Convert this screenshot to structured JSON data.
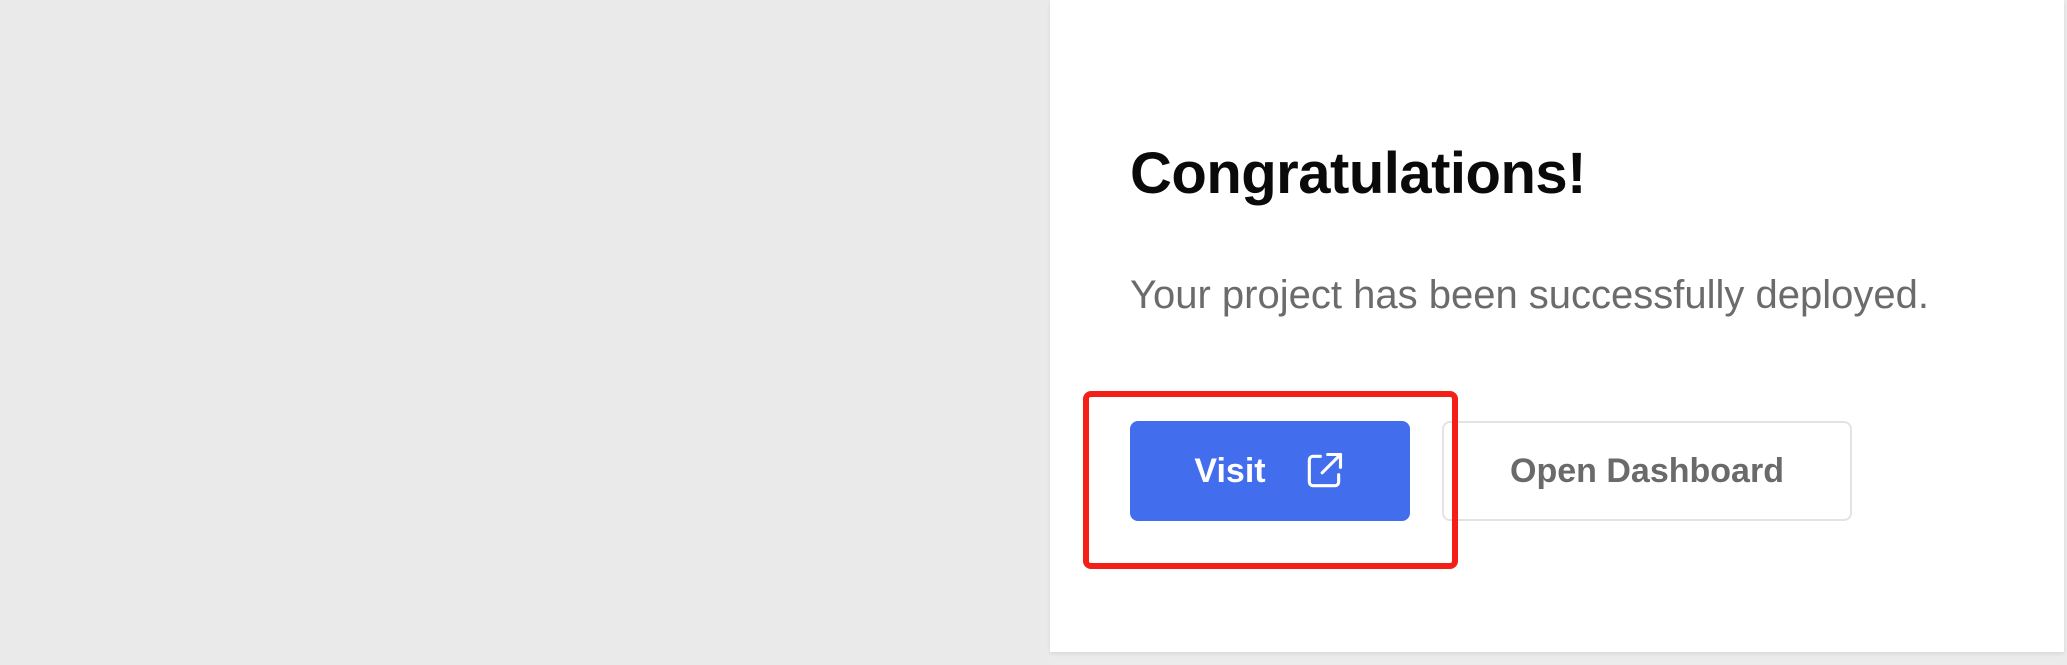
{
  "dialog": {
    "title": "Congratulations!",
    "message": "Your project has been successfully deployed.",
    "visit_label": "Visit",
    "dashboard_label": "Open Dashboard"
  },
  "icons": {
    "visit": "external-link-icon"
  },
  "colors": {
    "primary_button": "#426ded",
    "highlight_box": "#f41f16",
    "background": "#ebebeb",
    "card": "#ffffff"
  }
}
